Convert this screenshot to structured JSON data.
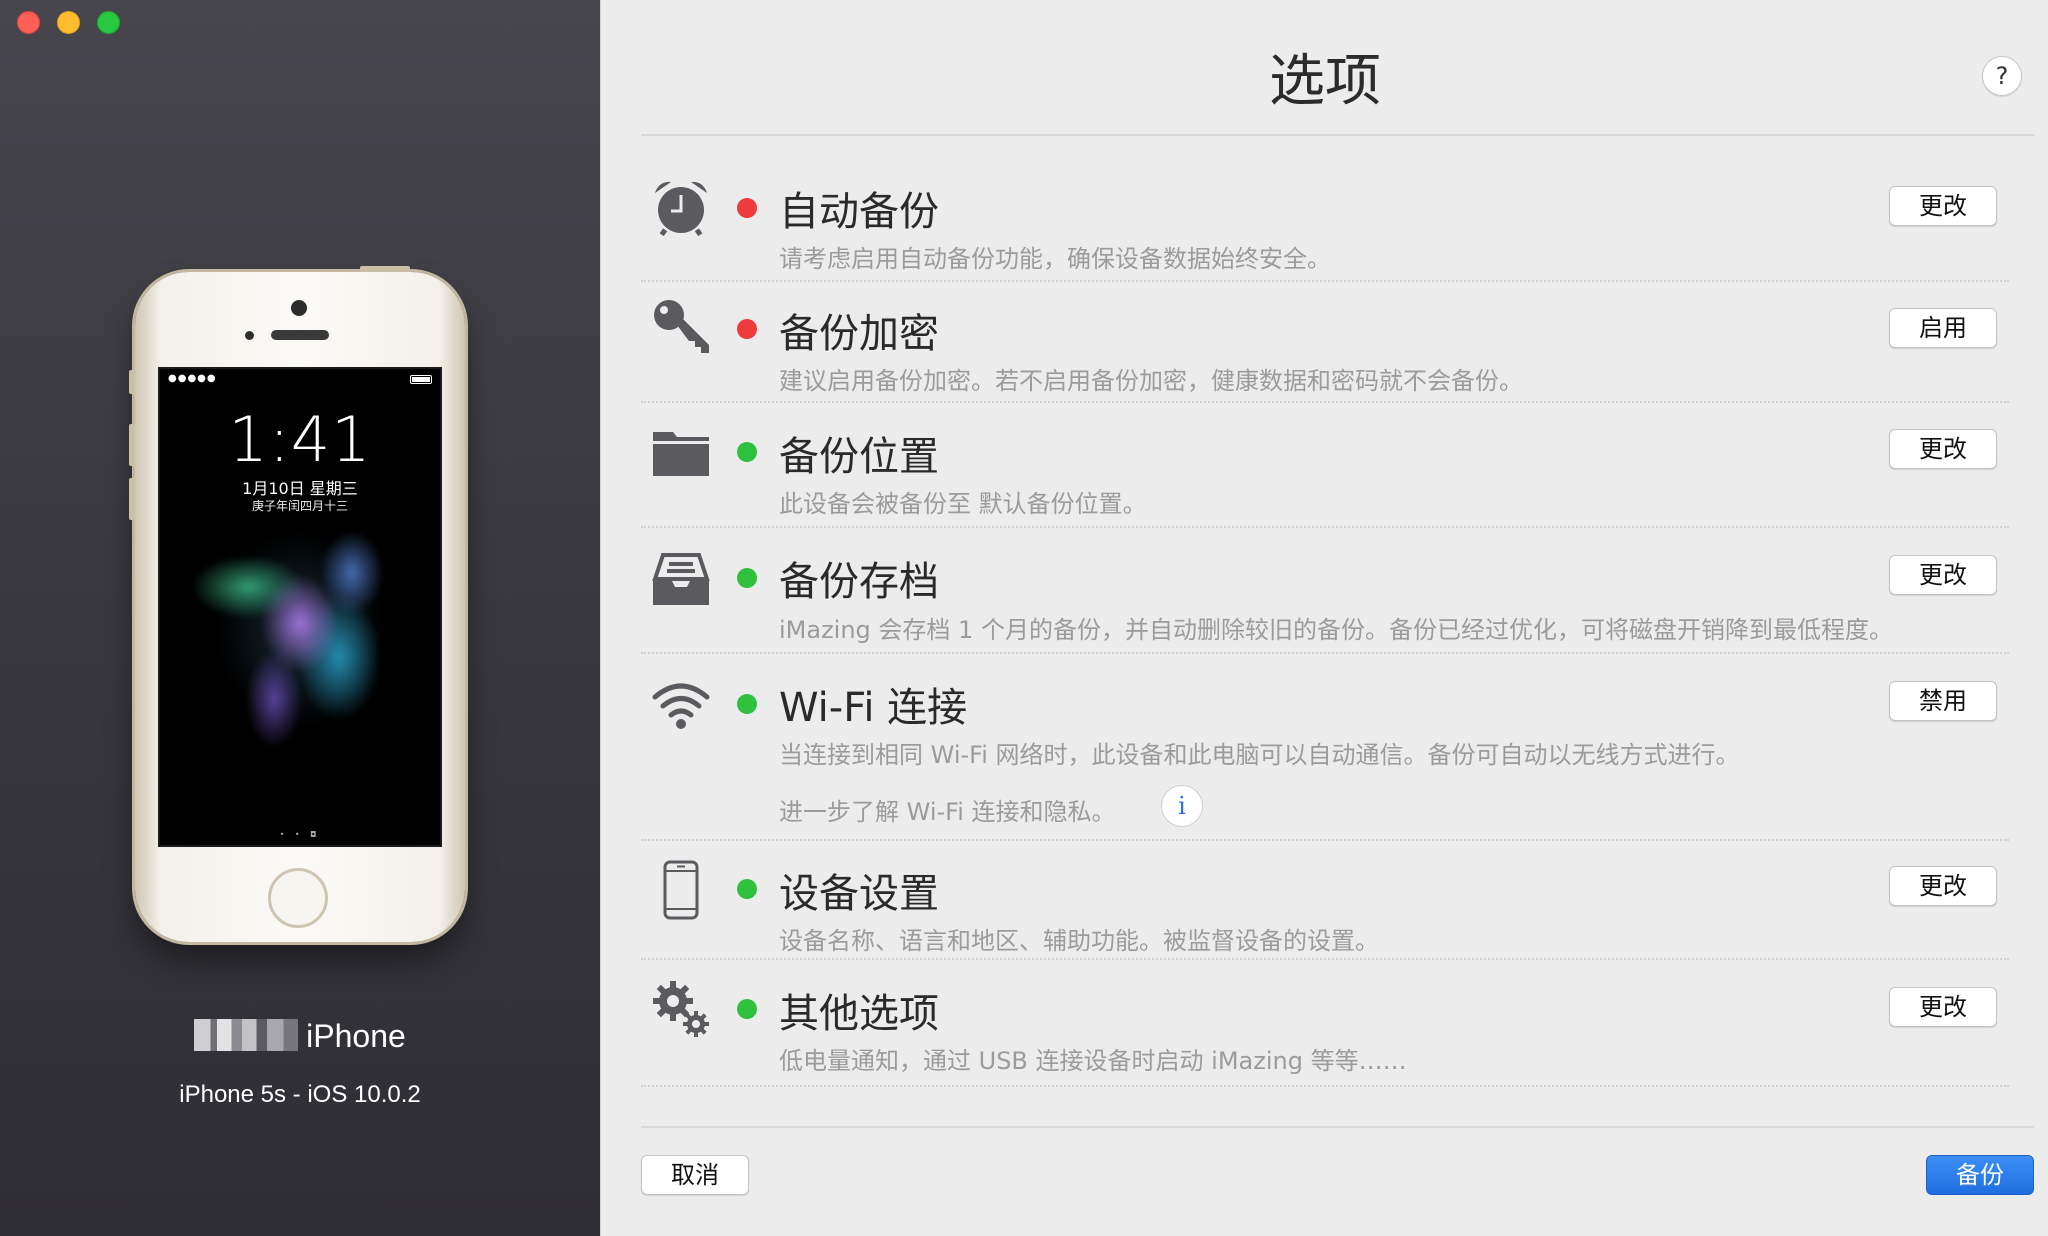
{
  "window": {
    "buttons": [
      "close",
      "minimize",
      "maximize"
    ]
  },
  "device": {
    "lockscreen": {
      "time": "1:41",
      "date": "1月10日 星期三",
      "lunar": "庚子年闰四月十三",
      "signal": "●●●●● ",
      "pager": "• • ◘"
    },
    "name_suffix": "iPhone",
    "model": "iPhone 5s - iOS 10.0.2"
  },
  "header": {
    "title": "选项",
    "help_label": "?"
  },
  "options": [
    {
      "icon": "alarm-clock-icon",
      "status": "red",
      "title": "自动备份",
      "description": "请考虑启用自动备份功能，确保设备数据始终安全。",
      "button": "更改"
    },
    {
      "icon": "key-icon",
      "status": "red",
      "title": "备份加密",
      "description": "建议启用备份加密。若不启用备份加密，健康数据和密码就不会备份。",
      "button": "启用"
    },
    {
      "icon": "folder-icon",
      "status": "green",
      "title": "备份位置",
      "description": "此设备会被备份至 默认备份位置。",
      "button": "更改"
    },
    {
      "icon": "archive-tray-icon",
      "status": "green",
      "title": "备份存档",
      "description": "iMazing 会存档 1 个月的备份，并自动删除较旧的备份。备份已经过优化，可将磁盘开销降到最低程度。",
      "button": "更改"
    },
    {
      "icon": "wifi-icon",
      "status": "green",
      "title": "Wi-Fi 连接",
      "description": "当连接到相同 Wi-Fi 网络时，此设备和此电脑可以自动通信。备份可自动以无线方式进行。",
      "extra": "进一步了解 Wi-Fi 连接和隐私。",
      "info_label": "i",
      "button": "禁用"
    },
    {
      "icon": "phone-outline-icon",
      "status": "green",
      "title": "设备设置",
      "description": "设备名称、语言和地区、辅助功能。被监督设备的设置。",
      "button": "更改"
    },
    {
      "icon": "gears-icon",
      "status": "green",
      "title": "其他选项",
      "description": "低电量通知，通过 USB 连接设备时启动 iMazing 等等……",
      "button": "更改"
    }
  ],
  "footer": {
    "cancel": "取消",
    "backup": "备份"
  },
  "colors": {
    "status_red": "#ee3b3b",
    "status_green": "#2fc03e",
    "primary_button": "#1f6fe0"
  }
}
